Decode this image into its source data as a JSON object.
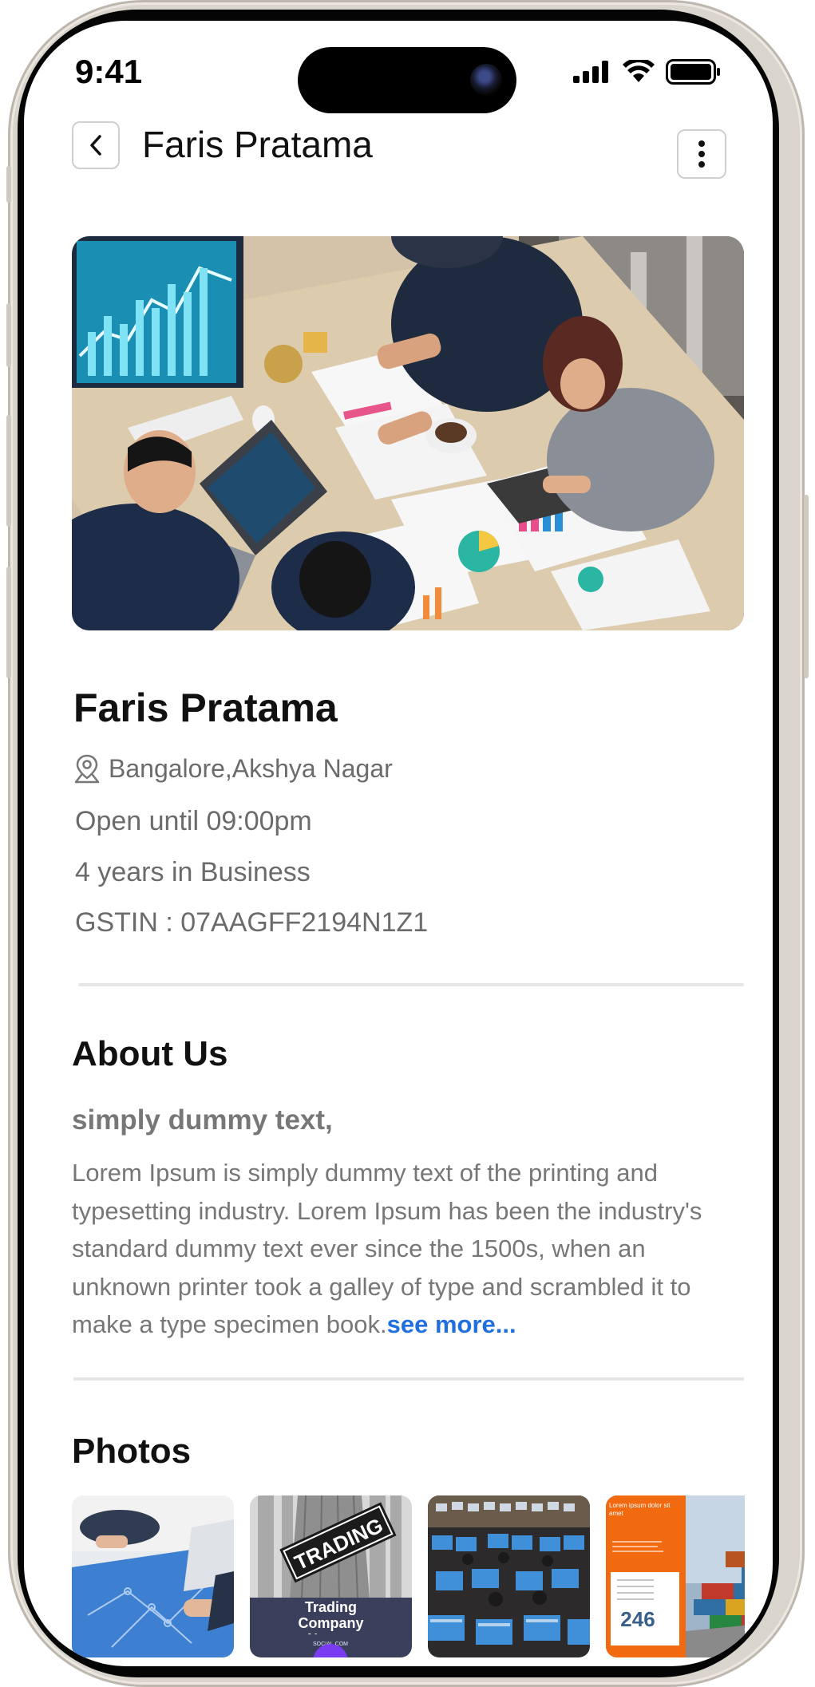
{
  "status_bar": {
    "time": "9:41"
  },
  "header": {
    "title": "Faris Pratama"
  },
  "business": {
    "name": "Faris Pratama",
    "location": "Bangalore,Akshya Nagar",
    "hours": "Open until 09:00pm",
    "years": "4 years in Business",
    "gstin": "GSTIN : 07AAGFF2194N1Z1"
  },
  "about": {
    "title": "About Us",
    "subtitle": "simply dummy text,",
    "body": "Lorem Ipsum is simply dummy text of the printing and typesetting industry. Lorem Ipsum has been the industry's standard dummy text ever since the 1500s, when an unknown printer took a galley of type and scrambled it to make a type specimen book.",
    "see_more": "see more..."
  },
  "photos": {
    "title": "Photos",
    "items": [
      {
        "name": "photo-business-meeting"
      },
      {
        "name": "photo-trading-company",
        "sign": "TRADING",
        "caption": "Trading Company Names",
        "small": "SOCIAL.COM"
      },
      {
        "name": "photo-trading-floor"
      },
      {
        "name": "photo-brochure",
        "heading": "Lorem ipsum dolor sit amet",
        "number": "246"
      }
    ]
  },
  "colors": {
    "accent": "#1f6fe0",
    "text": "#111111",
    "muted": "#777777"
  }
}
